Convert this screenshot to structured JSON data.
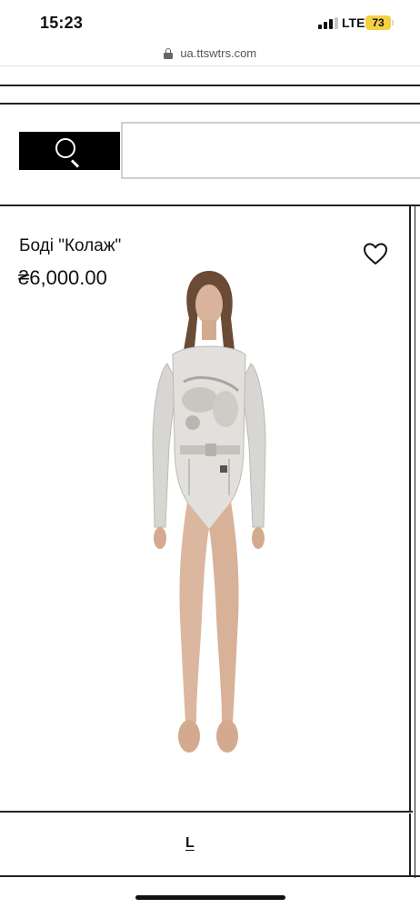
{
  "status_bar": {
    "time": "15:23",
    "network": "LTE",
    "battery": "73",
    "battery_color": "#f5d142"
  },
  "browser": {
    "url": "ua.ttswtrs.com",
    "lock_icon": "lock-icon"
  },
  "search": {
    "icon": "search-icon",
    "placeholder": "",
    "value": ""
  },
  "product": {
    "title": "Боді \"Колаж\"",
    "price": "₴6,000.00",
    "wishlist_icon": "heart-outline-icon",
    "image_alt": "model wearing collage print bodysuit"
  },
  "sizes": {
    "selected": "L"
  }
}
